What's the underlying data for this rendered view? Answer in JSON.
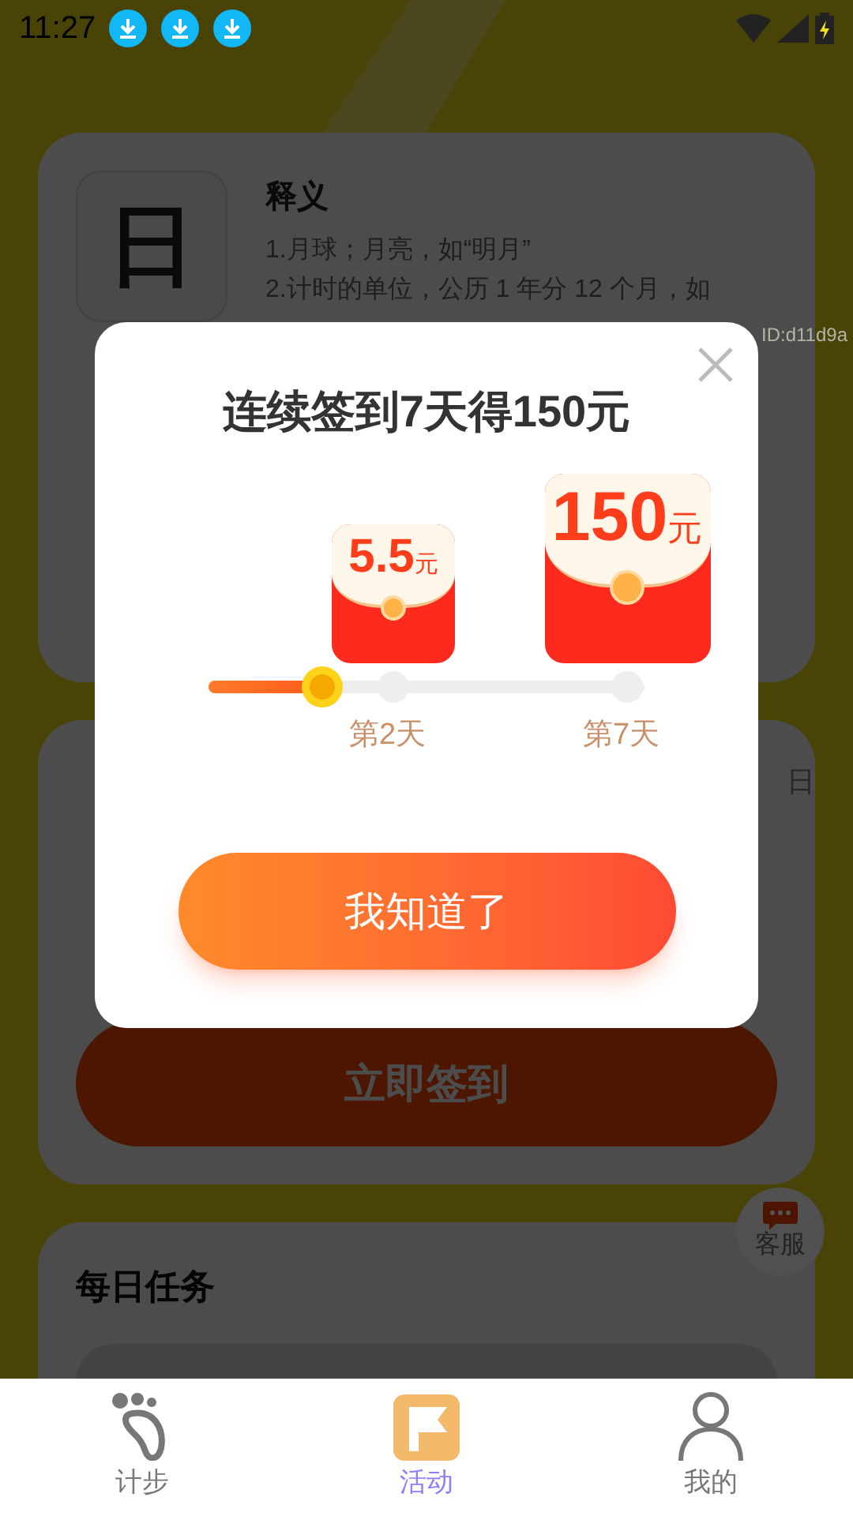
{
  "status_bar": {
    "time": "11:27"
  },
  "word_card": {
    "character": "日",
    "heading": "释义",
    "definitions": [
      "1.月球；月亮，如“明月”",
      "2.计时的单位，公历 1 年分 12 个月，如"
    ]
  },
  "id_label": "ID:d11d9a",
  "checkin_card": {
    "side_text": "日",
    "button": "立即签到"
  },
  "service_button": {
    "label": "客服"
  },
  "tasks_card": {
    "title": "每日任务"
  },
  "modal": {
    "title": "连续签到7天得150元",
    "rewards": [
      {
        "kind": "small",
        "amount": "5.5",
        "unit": "元",
        "day": "第2天"
      },
      {
        "kind": "large",
        "amount": "150",
        "unit": "元",
        "day": "第7天"
      }
    ],
    "progress": {
      "level": 0.26
    },
    "button": "我知道了"
  },
  "nav": [
    {
      "kind": "steps",
      "label": "计步",
      "selected": false
    },
    {
      "kind": "activity",
      "label": "活动",
      "selected": true
    },
    {
      "kind": "profile",
      "label": "我的",
      "selected": false
    }
  ]
}
